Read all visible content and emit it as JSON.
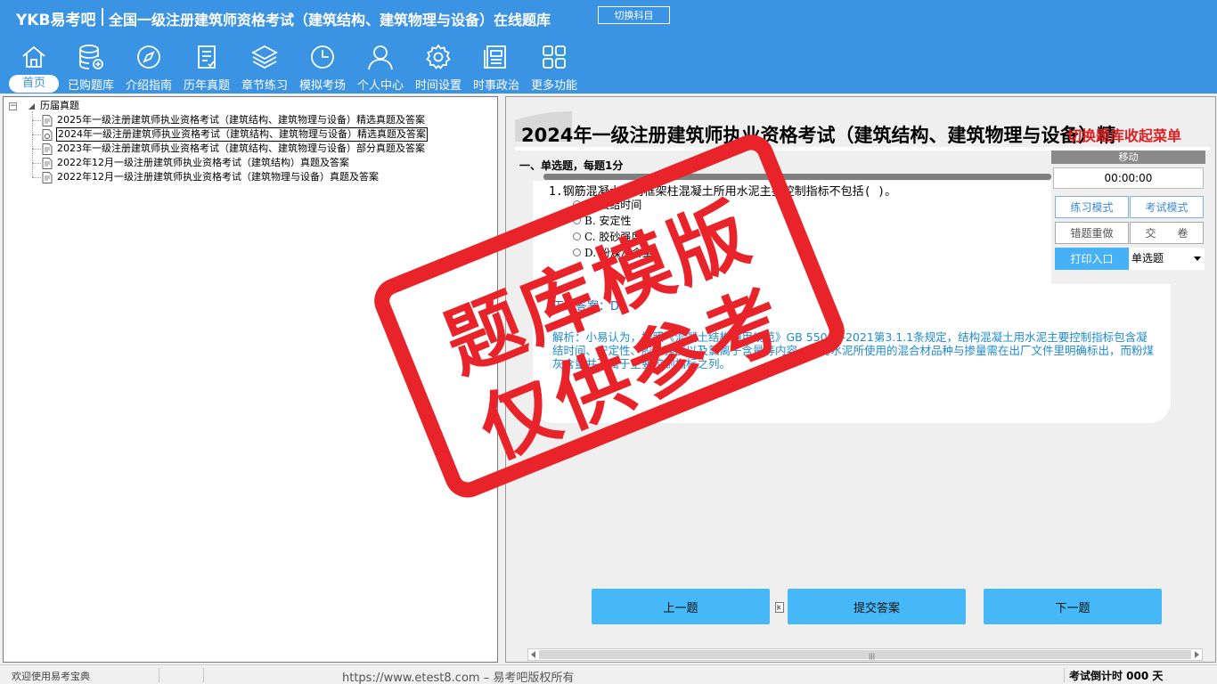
{
  "header": {
    "logo": "YKB易考吧",
    "title": "全国一级注册建筑师资格考试（建筑结构、建筑物理与设备）在线题库",
    "switch_label": "切换科目",
    "nav": [
      {
        "label": "首页",
        "icon": "home-icon"
      },
      {
        "label": "已购题库",
        "icon": "database-icon"
      },
      {
        "label": "介绍指南",
        "icon": "compass-icon"
      },
      {
        "label": "历年真题",
        "icon": "checklist-icon"
      },
      {
        "label": "章节练习",
        "icon": "layers-icon"
      },
      {
        "label": "模拟考场",
        "icon": "clock-icon"
      },
      {
        "label": "个人中心",
        "icon": "user-icon"
      },
      {
        "label": "时间设置",
        "icon": "gear-icon"
      },
      {
        "label": "时事政治",
        "icon": "news-icon"
      },
      {
        "label": "更多功能",
        "icon": "grid-icon"
      }
    ]
  },
  "tree": {
    "root": "历届真题",
    "items": [
      "2025年一级注册建筑师执业资格考试（建筑结构、建筑物理与设备）精选真题及答案",
      "2024年一级注册建筑师执业资格考试（建筑结构、建筑物理与设备）精选真题及答案",
      "2023年一级注册建筑师执业资格考试（建筑结构、建筑物理与设备）部分真题及答案",
      "2022年12月一级注册建筑师执业资格考试（建筑结构）真题及答案",
      "2022年12月一级注册建筑师执业资格考试（建筑物理与设备）真题及答案"
    ],
    "selected_index": 1
  },
  "paper": {
    "title": "2024年一级注册建筑师执业资格考试（建筑结构、建筑物理与设备）精",
    "title_overlay": "切换题库收起菜单",
    "section": "一、单选题，每题1分",
    "question": "1.钢筋混凝土结构框架柱混凝土所用水泥主要控制指标不包括( )。",
    "options": [
      "A. 凝结时间",
      "B. 安定性",
      "C. 胶砂强度",
      "D. 粉煤灰含量"
    ],
    "answer": "正确答案：D",
    "analysis": "解析：小易认为，按照《混凝土结构通用规范》GB 55008-2021第3.1.1条规定，结构混凝土用水泥主要控制指标包含凝结时间、安定性、胶砂强度以及氯离子含量等内容，同时水泥所使用的混合材品种与掺量需在出厂文件里明确标出，而粉煤灰含量并不属于主要控制指标之列。"
  },
  "timer_panel": {
    "move_label": "移动",
    "time": "00:00:00",
    "practice_mode": "练习模式",
    "exam_mode": "考试模式",
    "redo_wrong": "错题重做",
    "submit_paper": "交　　卷",
    "print": "打印入口",
    "question_type": "单选题"
  },
  "buttons": {
    "prev": "上一题",
    "submit": "提交答案",
    "next": "下一题"
  },
  "status": {
    "welcome": "欢迎使用易考宝典",
    "copyright": "https://www.etest8.com – 易考吧版权所有",
    "countdown": "考试倒计时 000 天"
  },
  "watermark": {
    "line1": "题库模版",
    "line2": "仅供参考"
  },
  "colors": {
    "header_bg": "#3b93e3",
    "button_blue": "#46b8f7",
    "stamp_red": "#e8242a",
    "answer_blue": "#1e6fd0"
  }
}
